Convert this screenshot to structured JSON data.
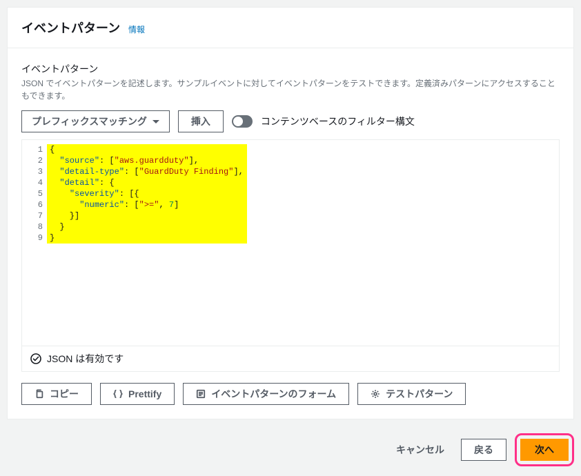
{
  "header": {
    "title": "イベントパターン",
    "info_link": "情報"
  },
  "field": {
    "label": "イベントパターン",
    "description": "JSON でイベントパターンを記述します。サンプルイベントに対してイベントパターンをテストできます。定義済みパターンにアクセスすることもできます。"
  },
  "controls": {
    "dropdown_label": "プレフィックスマッチング",
    "insert_label": "挿入",
    "toggle_label": "コンテンツベースのフィルター構文"
  },
  "code": {
    "lines": 9,
    "l1a": "{",
    "l2k": "\"source\"",
    "l2p": ": [",
    "l2v": "\"aws.guardduty\"",
    "l2e": "],",
    "l3k": "\"detail-type\"",
    "l3p": ": [",
    "l3v": "\"GuardDuty Finding\"",
    "l3e": "],",
    "l4k": "\"detail\"",
    "l4p": ": {",
    "l5k": "\"severity\"",
    "l5p": ": [{",
    "l6k": "\"numeric\"",
    "l6p": ": [",
    "l6v": "\">=\"",
    "l6c": ", ",
    "l6n": "7",
    "l6e": "]",
    "l7": "    }]",
    "l8": "  }",
    "l9": "}"
  },
  "status": {
    "valid_text": "JSON は有効です"
  },
  "actions": {
    "copy": "コピー",
    "prettify": "Prettify",
    "form": "イベントパターンのフォーム",
    "test": "テストパターン"
  },
  "footer": {
    "cancel": "キャンセル",
    "back": "戻る",
    "next": "次へ"
  }
}
